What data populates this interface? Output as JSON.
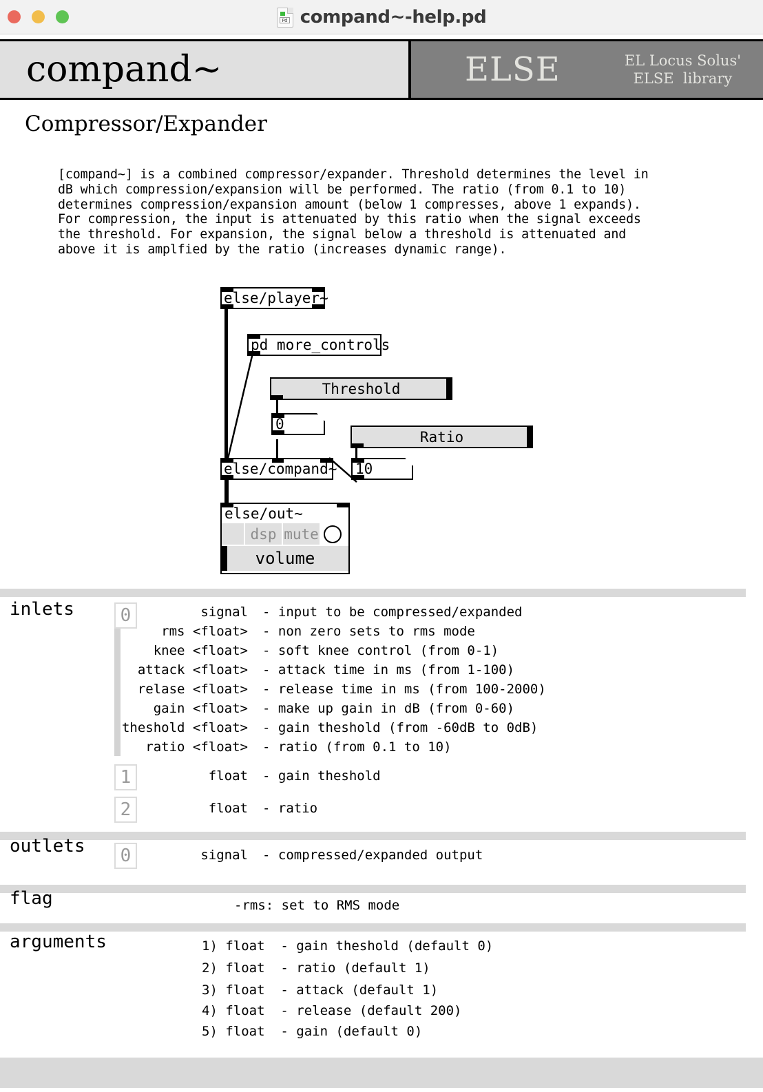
{
  "window": {
    "title": "compand~-help.pd",
    "file_icon": "pd-document-icon",
    "close_label": "close",
    "minimize_label": "minimize",
    "maximize_label": "maximize"
  },
  "banner": {
    "object_name": "compand~",
    "logo": "ELSE",
    "subtitle_line1": "EL Locus Solus'",
    "subtitle_line2": "ELSE  library",
    "bg_gray": "#808080",
    "bg_light": "#e0e0e0"
  },
  "subtitle": "Compressor/Expander",
  "description": "[compand~] is a combined compressor/expander. Threshold determines the level in\ndB which compression/expansion will be performed. The ratio (from 0.1 to 10)\ndetermines compression/expansion amount (below 1 compresses, above 1 expands).\nFor compression, the input is attenuated by this ratio when the signal exceeds\nthe threshold. For expansion, the signal below a threshold is attenuated and\nabove it is amplfied by the ratio (increases dynamic range).",
  "patch": {
    "player": "else/player~",
    "more_controls": "pd more_controls",
    "threshold_slider_label": "Threshold",
    "threshold_value": "0",
    "ratio_slider_label": "Ratio",
    "ratio_value": "10",
    "compand": "else/compand~",
    "out": "else/out~",
    "dsp_toggle": "dsp",
    "mute_toggle": "mute",
    "volume_label": "volume"
  },
  "reference": {
    "inlets_label": "inlets",
    "outlets_label": "outlets",
    "flag_label": "flag",
    "arguments_label": "arguments",
    "inlets": [
      {
        "index": "0",
        "rows": [
          {
            "name": "signal",
            "desc": "- input to be compressed/expanded"
          },
          {
            "name": "rms <float>",
            "desc": "- non zero sets to rms mode"
          },
          {
            "name": "knee <float>",
            "desc": "- soft knee control (from 0-1)"
          },
          {
            "name": "attack <float>",
            "desc": "- attack time in ms (from 1-100)"
          },
          {
            "name": "relase <float>",
            "desc": "- release time in ms (from 100-2000)"
          },
          {
            "name": "gain <float>",
            "desc": "- make up gain in dB (from 0-60)"
          },
          {
            "name": "theshold <float>",
            "desc": "- gain theshold (from -60dB to 0dB)"
          },
          {
            "name": "ratio <float>",
            "desc": "- ratio (from 0.1 to 10)"
          }
        ]
      },
      {
        "index": "1",
        "rows": [
          {
            "name": "float",
            "desc": "- gain theshold"
          }
        ]
      },
      {
        "index": "2",
        "rows": [
          {
            "name": "float",
            "desc": "- ratio"
          }
        ]
      }
    ],
    "outlets": [
      {
        "index": "0",
        "rows": [
          {
            "name": "signal",
            "desc": "- compressed/expanded output"
          }
        ]
      }
    ],
    "flag_text": "-rms: set to RMS mode",
    "arguments": [
      "1) float  - gain theshold (default 0)",
      "2) float  - ratio (default 1)",
      "3) float  - attack (default 1)",
      "4) float  - release (default 200)",
      "5) float  - gain (default 0)"
    ]
  }
}
